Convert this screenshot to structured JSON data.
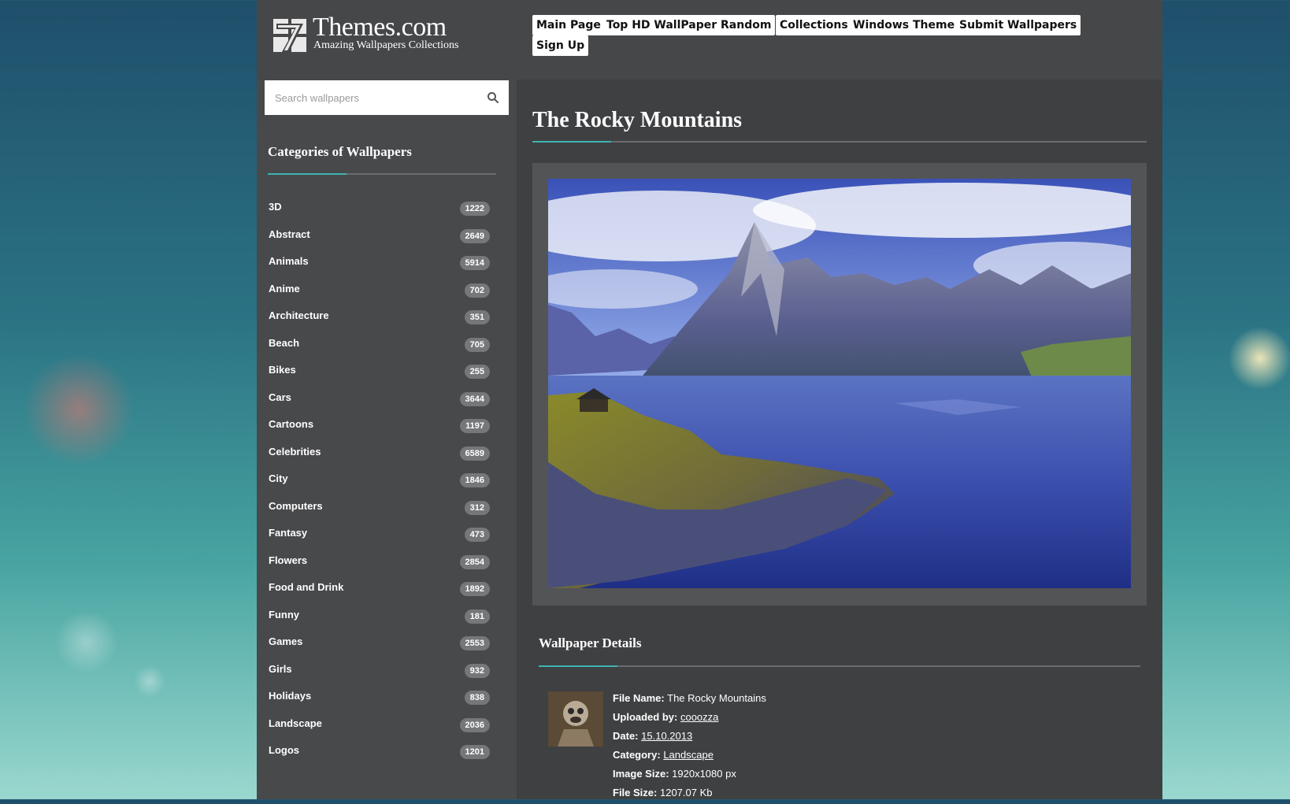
{
  "brand": {
    "title": "Themes.com",
    "subtitle": "Amazing Wallpapers Collections",
    "mark": "7"
  },
  "nav": [
    {
      "label": "Main Page"
    },
    {
      "label": "Top HD WallPapers"
    },
    {
      "label": "Random"
    },
    {
      "label": "Collections"
    },
    {
      "label": "Windows Themes"
    },
    {
      "label": "Submit Wallpapers"
    },
    {
      "label": "Sign Up"
    }
  ],
  "search": {
    "placeholder": "Search wallpapers",
    "icon": "search-icon"
  },
  "sidebar": {
    "title": "Categories of Wallpapers",
    "categories": [
      {
        "name": "3D",
        "count": "1222"
      },
      {
        "name": "Abstract",
        "count": "2649"
      },
      {
        "name": "Animals",
        "count": "5914"
      },
      {
        "name": "Anime",
        "count": "702"
      },
      {
        "name": "Architecture",
        "count": "351"
      },
      {
        "name": "Beach",
        "count": "705"
      },
      {
        "name": "Bikes",
        "count": "255"
      },
      {
        "name": "Cars",
        "count": "3644"
      },
      {
        "name": "Cartoons",
        "count": "1197"
      },
      {
        "name": "Celebrities",
        "count": "6589"
      },
      {
        "name": "City",
        "count": "1846"
      },
      {
        "name": "Computers",
        "count": "312"
      },
      {
        "name": "Fantasy",
        "count": "473"
      },
      {
        "name": "Flowers",
        "count": "2854"
      },
      {
        "name": "Food and Drink",
        "count": "1892"
      },
      {
        "name": "Funny",
        "count": "181"
      },
      {
        "name": "Games",
        "count": "2553"
      },
      {
        "name": "Girls",
        "count": "932"
      },
      {
        "name": "Holidays",
        "count": "838"
      },
      {
        "name": "Landscape",
        "count": "2036"
      },
      {
        "name": "Logos",
        "count": "1201"
      }
    ]
  },
  "main": {
    "title": "The Rocky Mountains",
    "details_title": "Wallpaper Details",
    "details": {
      "file_name_label": "File Name:",
      "file_name": "The Rocky Mountains",
      "uploaded_by_label": "Uploaded by:",
      "uploaded_by": "cooozza",
      "date_label": "Date:",
      "date": "15.10.2013",
      "category_label": "Category:",
      "category": "Landscape",
      "image_size_label": "Image Size:",
      "image_size": "1920x1080 px",
      "file_size_label": "File Size:",
      "file_size": "1207.07 Kb"
    }
  },
  "colors": {
    "accent": "#3fb4b0",
    "page_bg": "#3f4042",
    "sidebar_bg": "#48494b",
    "badge_bg": "#767779"
  }
}
